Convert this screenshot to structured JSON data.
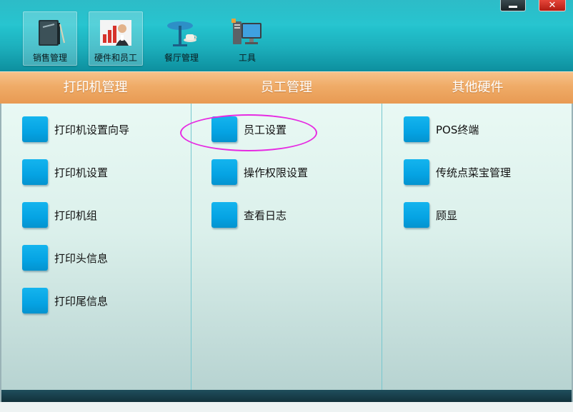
{
  "toolbar": {
    "items": [
      {
        "label": "销售管理",
        "icon": "sales-book-icon",
        "active": true
      },
      {
        "label": "硬件和员工",
        "icon": "hardware-staff-icon",
        "active": true
      },
      {
        "label": "餐厅管理",
        "icon": "restaurant-table-icon",
        "active": false
      },
      {
        "label": "工具",
        "icon": "tools-computer-icon",
        "active": false
      }
    ]
  },
  "window_controls": {
    "minimize_icon": "minimize-icon",
    "close_symbol": "✕",
    "close_icon": "close-icon"
  },
  "sections": [
    {
      "title": "打印机管理",
      "items": [
        "打印机设置向导",
        "打印机设置",
        "打印机组",
        "打印头信息",
        "打印尾信息"
      ]
    },
    {
      "title": "员工管理",
      "items": [
        "员工设置",
        "操作权限设置",
        "查看日志"
      ]
    },
    {
      "title": "其他硬件",
      "items": [
        "POS终端",
        "传统点菜宝管理",
        "顾显"
      ]
    }
  ],
  "annotation": {
    "highlighted_item": "员工设置",
    "color": "#e62be2"
  },
  "colors": {
    "toolbar_teal": "#1db0bd",
    "header_orange": "#efab67",
    "tile_blue": "#05a3e3",
    "divider": "#76c7cf"
  }
}
